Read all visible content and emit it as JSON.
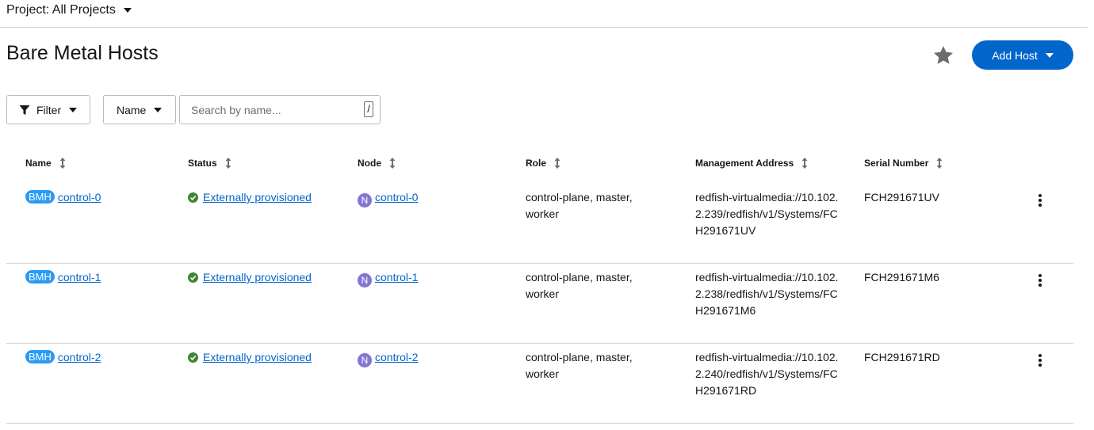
{
  "project": {
    "label": "Project: All Projects"
  },
  "page": {
    "title": "Bare Metal Hosts"
  },
  "header": {
    "add_host_label": "Add Host",
    "star_icon": "star-icon"
  },
  "toolbar": {
    "filter_label": "Filter",
    "name_label": "Name",
    "search_placeholder": "Search by name...",
    "search_shortcut": "/"
  },
  "table": {
    "columns": [
      "Name",
      "Status",
      "Node",
      "Role",
      "Management Address",
      "Serial Number"
    ],
    "rows": [
      {
        "badge": "BMH",
        "name": "control-0",
        "status": "Externally provisioned",
        "node_badge": "N",
        "node": "control-0",
        "role": "control-plane, master, worker",
        "management_address": "redfish-virtualmedia://10.102.2.239/redfish/v1/Systems/FCH291671UV",
        "serial_number": "FCH291671UV"
      },
      {
        "badge": "BMH",
        "name": "control-1",
        "status": "Externally provisioned",
        "node_badge": "N",
        "node": "control-1",
        "role": "control-plane, master, worker",
        "management_address": "redfish-virtualmedia://10.102.2.238/redfish/v1/Systems/FCH291671M6",
        "serial_number": "FCH291671M6"
      },
      {
        "badge": "BMH",
        "name": "control-2",
        "status": "Externally provisioned",
        "node_badge": "N",
        "node": "control-2",
        "role": "control-plane, master, worker",
        "management_address": "redfish-virtualmedia://10.102.2.240/redfish/v1/Systems/FCH291671RD",
        "serial_number": "FCH291671RD"
      }
    ]
  },
  "colors": {
    "primary": "#0066cc",
    "bmh_badge": "#2b9af3",
    "node_badge": "#8476d1",
    "success": "#3e8635"
  }
}
